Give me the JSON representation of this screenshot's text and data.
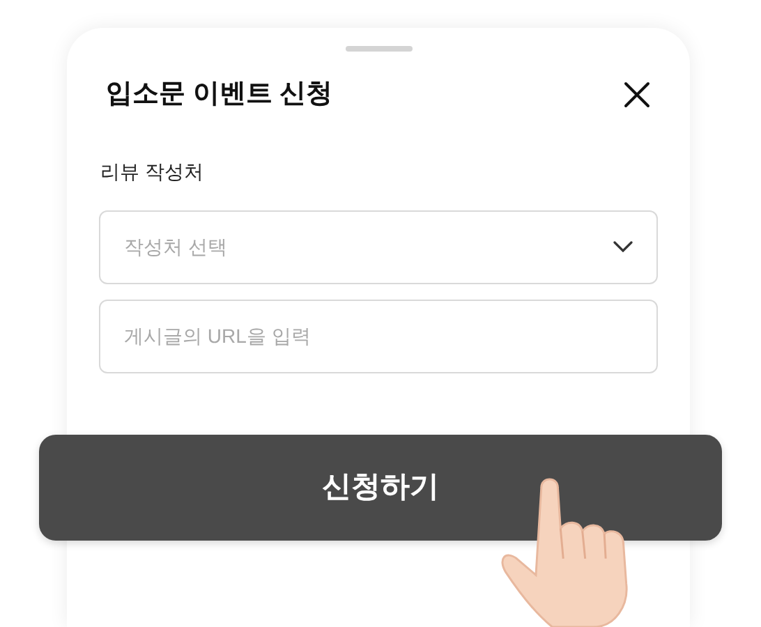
{
  "sheet": {
    "title": "입소문 이벤트 신청"
  },
  "form": {
    "label": "리뷰 작성처",
    "source_select": {
      "placeholder": "작성처 선택"
    },
    "url_input": {
      "placeholder": "게시글의 URL을 입력"
    }
  },
  "submit_button": {
    "label": "신청하기"
  }
}
